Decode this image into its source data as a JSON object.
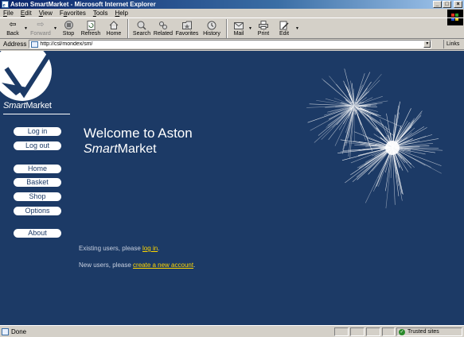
{
  "window": {
    "title": "Aston SmartMarket - Microsoft Internet Explorer"
  },
  "menu": {
    "items": [
      {
        "label": "File",
        "accel": "F",
        "rest": "ile"
      },
      {
        "label": "Edit",
        "accel": "E",
        "rest": "dit"
      },
      {
        "label": "View",
        "accel": "V",
        "rest": "iew"
      },
      {
        "label": "Favorites",
        "accel": "a",
        "pre": "F",
        "rest": "vorites"
      },
      {
        "label": "Tools",
        "accel": "T",
        "rest": "ools"
      },
      {
        "label": "Help",
        "accel": "H",
        "rest": "elp"
      }
    ]
  },
  "toolbar": {
    "back": "Back",
    "forward": "Forward",
    "stop": "Stop",
    "refresh": "Refresh",
    "home": "Home",
    "search": "Search",
    "related": "Related",
    "favorites": "Favorites",
    "history": "History",
    "mail": "Mail",
    "print": "Print",
    "edit": "Edit"
  },
  "address": {
    "label": "Address",
    "value": "http://csl/mondex/sm/",
    "links": "Links"
  },
  "page": {
    "logo_text_italic": "Smart",
    "logo_text_rest": "Market",
    "nav": {
      "login": "Log in",
      "logout": "Log out",
      "home": "Home",
      "basket": "Basket",
      "shop": "Shop",
      "options": "Options",
      "about": "About"
    },
    "welcome_line1": "Welcome to Aston",
    "welcome_line2_italic": "Smart",
    "welcome_line2_rest": "Market",
    "existing_prefix": "Existing users, please ",
    "existing_link": "log in",
    "existing_suffix": ".",
    "new_prefix": "New users, please ",
    "new_link": "create a new account",
    "new_suffix": "."
  },
  "status": {
    "text": "Done",
    "zone": "Trusted sites"
  },
  "colors": {
    "page_background": "#1c3a66",
    "link": "#ffd700",
    "title_bar": "#0a246a"
  }
}
